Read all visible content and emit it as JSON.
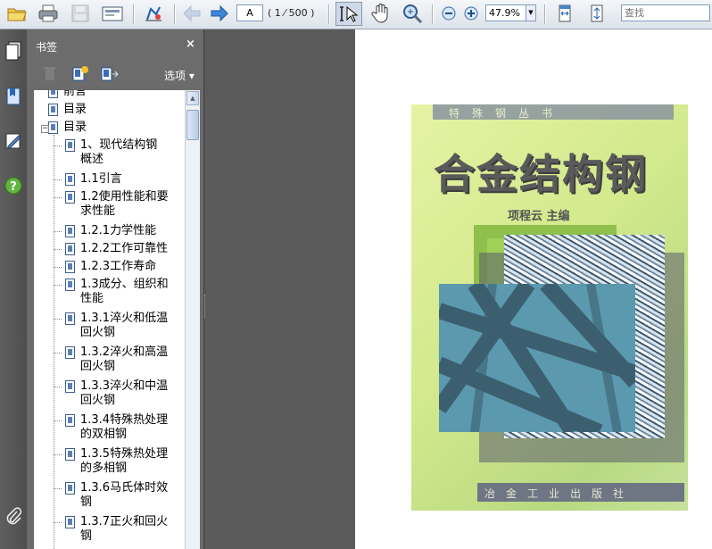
{
  "toolbar": {
    "page_input": "A",
    "page_count": "( 1 ⁄ 500 )",
    "zoom_value": "47.9%",
    "search_placeholder": "查找",
    "icons": [
      "open-icon",
      "print-icon",
      "save-icon",
      "email-icon",
      "home-icon",
      "previous-page-icon",
      "next-page-icon",
      "select-text-icon",
      "hand-tool-icon",
      "zoom-tool-icon",
      "zoom-out-icon",
      "zoom-in-icon",
      "fit-width-icon",
      "fit-page-icon"
    ]
  },
  "rail": {
    "icons": [
      "pages-icon",
      "bookmarks-icon",
      "signatures-icon",
      "help-icon",
      "attachments-icon"
    ]
  },
  "bookmarks_panel": {
    "title": "书签",
    "close": "×",
    "options_label": "选项 ▾",
    "items": [
      {
        "label_lines": [
          "前言"
        ]
      },
      {
        "label_lines": [
          "目录"
        ]
      },
      {
        "label_lines": [
          "目录"
        ]
      },
      {
        "label_lines": [
          "1、现代结构钢",
          "概述"
        ]
      },
      {
        "label_lines": [
          "1.1引言"
        ]
      },
      {
        "label_lines": [
          "1.2使用性能和要",
          "求性能"
        ]
      },
      {
        "label_lines": [
          "1.2.1力学性能"
        ]
      },
      {
        "label_lines": [
          "1.2.2工作可靠性"
        ]
      },
      {
        "label_lines": [
          "1.2.3工作寿命"
        ]
      },
      {
        "label_lines": [
          "1.3成分、组织和",
          "性能"
        ]
      },
      {
        "label_lines": [
          "1.3.1淬火和低温",
          "回火钢"
        ]
      },
      {
        "label_lines": [
          "1.3.2淬火和高温",
          "回火钢"
        ]
      },
      {
        "label_lines": [
          "1.3.3淬火和中温",
          "回火钢"
        ]
      },
      {
        "label_lines": [
          "1.3.4特殊热处理",
          "的双相钢"
        ]
      },
      {
        "label_lines": [
          "1.3.5特殊热处理",
          "的多相钢"
        ]
      },
      {
        "label_lines": [
          "1.3.6马氏体时效",
          "钢"
        ]
      },
      {
        "label_lines": [
          "1.3.7正火和回火",
          "钢"
        ]
      }
    ]
  },
  "cover": {
    "series": "特殊钢丛书",
    "title": "合金结构钢",
    "author": "项程云 主编",
    "publisher": "冶金工业出版社"
  },
  "colors": {
    "toolbar_bg": "#e6eaf0",
    "panel_bg": "#6b6b6b",
    "doc_bg": "#5a5a5a",
    "bookmark_icon": "#3d5f8e"
  }
}
